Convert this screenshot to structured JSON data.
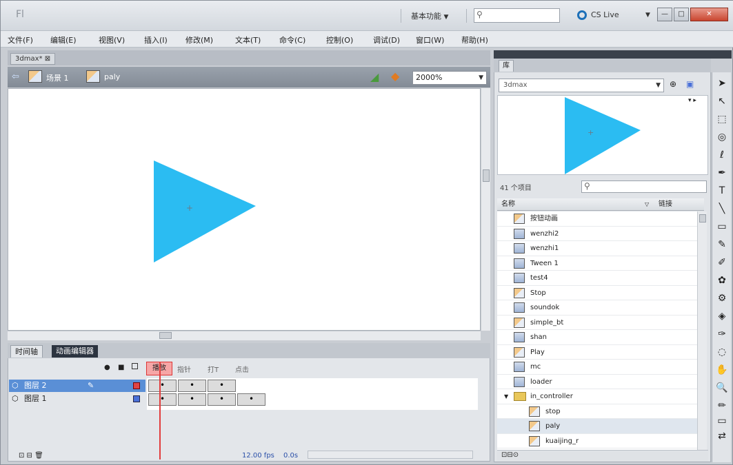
{
  "titlebar": {
    "logo": "Fl",
    "workspace": "基本功能",
    "search_placeholder": "",
    "cslive": "CS Live",
    "min": "—",
    "max": "□",
    "close": "✕"
  },
  "menu": [
    "文件(F)",
    "编辑(E)",
    "视图(V)",
    "插入(I)",
    "修改(M)",
    "文本(T)",
    "命令(C)",
    "控制(O)",
    "调试(D)",
    "窗口(W)",
    "帮助(H)"
  ],
  "document": {
    "tab": "3dmax*",
    "scene": "场景 1",
    "symbol": "paly",
    "zoom": "2000%"
  },
  "timeline": {
    "tabs": [
      "时间轴",
      "动画编辑器"
    ],
    "header_labels": [
      "播放",
      "指针",
      "打T",
      "点击"
    ],
    "layers": [
      "图层 2",
      "图层 1"
    ],
    "status": [
      "12.00 fps",
      "0.0s"
    ]
  },
  "library": {
    "tab": "库",
    "source": "3dmax",
    "count": "41 个项目",
    "col_name": "名称",
    "col_link": "链接",
    "items": [
      {
        "name": "按钮动画",
        "type": "mc"
      },
      {
        "name": "wenzhi2",
        "type": "btn"
      },
      {
        "name": "wenzhi1",
        "type": "btn"
      },
      {
        "name": "Tween 1",
        "type": "btn"
      },
      {
        "name": "test4",
        "type": "btn"
      },
      {
        "name": "Stop",
        "type": "mc"
      },
      {
        "name": "soundok",
        "type": "btn"
      },
      {
        "name": "simple_bt",
        "type": "mc"
      },
      {
        "name": "shan",
        "type": "btn"
      },
      {
        "name": "Play",
        "type": "mc"
      },
      {
        "name": "mc",
        "type": "btn"
      },
      {
        "name": "loader",
        "type": "btn"
      },
      {
        "name": "in_controller",
        "type": "folder"
      },
      {
        "name": "stop",
        "type": "mc"
      },
      {
        "name": "paly",
        "type": "mc"
      },
      {
        "name": "kuaijing_r",
        "type": "mc"
      }
    ]
  },
  "colors": {
    "triangle": "#2bbcf2",
    "playhead": "#e23c3c",
    "selected_layer": "#5a8fd6"
  },
  "tools": [
    "selection-icon",
    "subselection-icon",
    "free-transform-icon",
    "3d-rotation-icon",
    "lasso-icon",
    "pen-icon",
    "text-icon",
    "line-icon",
    "rectangle-icon",
    "pencil-icon",
    "brush-icon",
    "deco-icon",
    "bone-icon",
    "paint-bucket-icon",
    "eyedropper-icon",
    "eraser-icon",
    "hand-icon",
    "zoom-icon",
    "stroke-color-icon",
    "fill-color-icon",
    "swap-icon"
  ]
}
